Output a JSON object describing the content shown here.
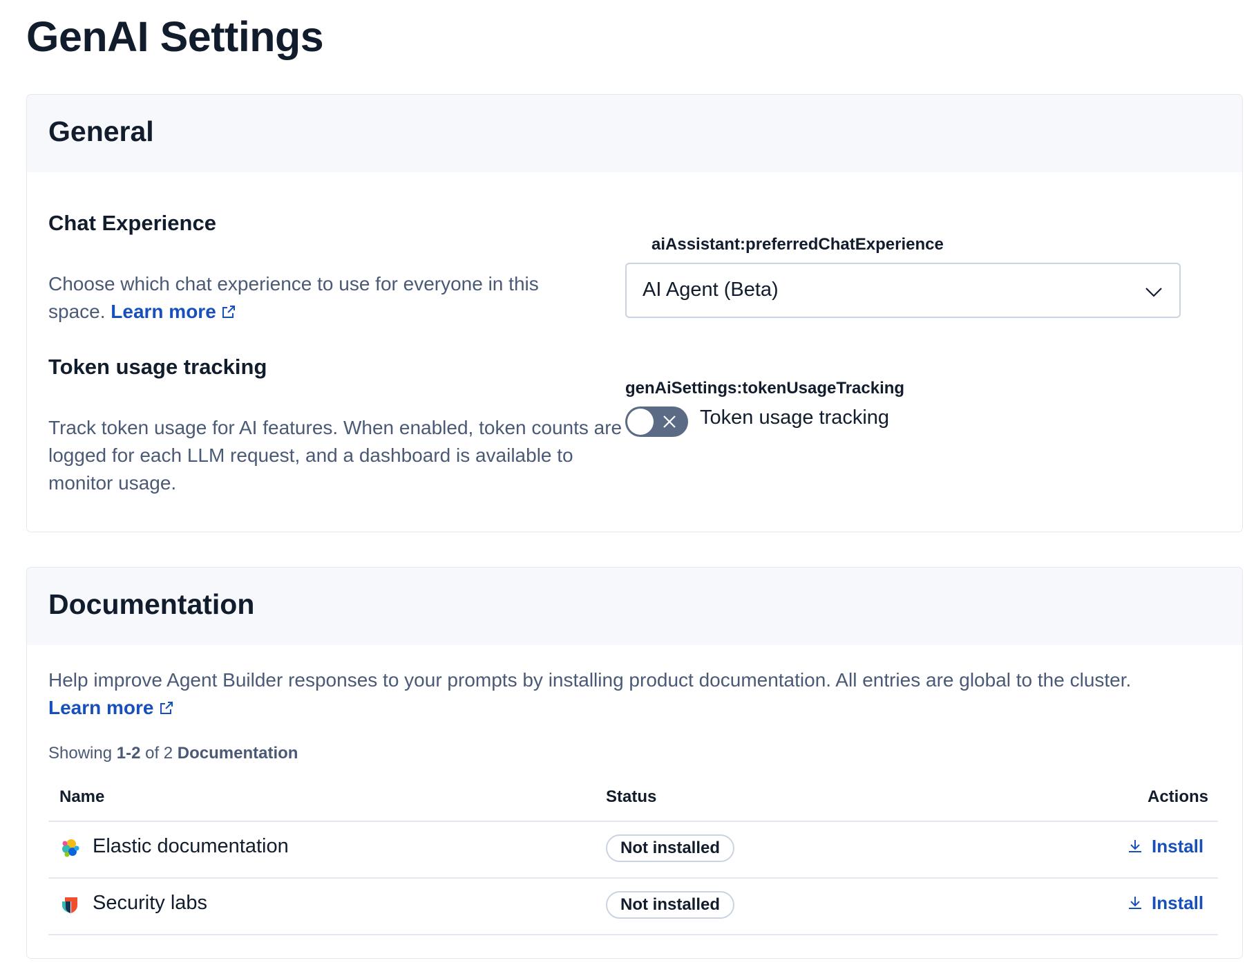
{
  "page": {
    "title": "GenAI Settings"
  },
  "general": {
    "heading": "General",
    "chat_experience": {
      "title": "Chat Experience",
      "description": "Choose which chat experience to use for everyone in this space.",
      "learn_more": "Learn more",
      "field_key": "aiAssistant:preferredChatExperience",
      "selected_value": "AI Agent (Beta)"
    },
    "token_usage": {
      "title": "Token usage tracking",
      "description": "Track token usage for AI features. When enabled, token counts are logged for each LLM request, and a dashboard is available to monitor usage.",
      "field_key": "genAiSettings:tokenUsageTracking",
      "toggle_label": "Token usage tracking",
      "enabled": false
    }
  },
  "documentation": {
    "heading": "Documentation",
    "description": "Help improve Agent Builder responses to your prompts by installing product documentation. All entries are global to the cluster.",
    "learn_more": "Learn more",
    "showing": {
      "prefix": "Showing",
      "range": "1-2",
      "of": "of 2",
      "label": "Documentation"
    },
    "columns": {
      "name": "Name",
      "status": "Status",
      "actions": "Actions"
    },
    "rows": [
      {
        "name": "Elastic documentation",
        "icon": "elastic-logo-icon",
        "status": "Not installed",
        "action": "Install"
      },
      {
        "name": "Security labs",
        "icon": "security-labs-logo-icon",
        "status": "Not installed",
        "action": "Install"
      }
    ]
  },
  "colors": {
    "accent": "#1750ba",
    "text": "#111c2c",
    "subdued": "#4a5a76",
    "toggle_off": "#5b6b86"
  }
}
